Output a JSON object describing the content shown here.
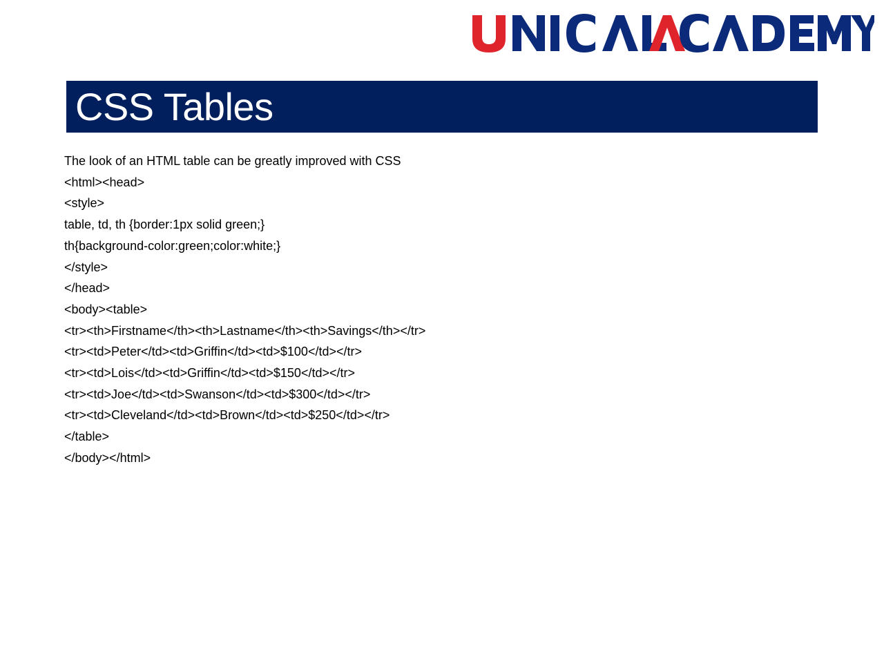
{
  "logo": {
    "text_part1": "UNICAL",
    "text_part2": "ACADEMY",
    "accent_color": "#e0242b",
    "brand_color": "#0b2a7a"
  },
  "slide": {
    "title": "CSS Tables",
    "title_bar_color": "#001f5c",
    "lines": [
      "The look of an HTML table can be greatly improved with CSS",
      "<html><head>",
      "<style>",
      "table, td, th {border:1px solid green;}",
      "th{background-color:green;color:white;}",
      "</style>",
      "</head>",
      "<body><table>",
      "<tr><th>Firstname</th><th>Lastname</th><th>Savings</th></tr>",
      "<tr><td>Peter</td><td>Griffin</td><td>$100</td></tr>",
      "<tr><td>Lois</td><td>Griffin</td><td>$150</td></tr>",
      "<tr><td>Joe</td><td>Swanson</td><td>$300</td></tr>",
      "<tr><td>Cleveland</td><td>Brown</td><td>$250</td></tr>",
      "</table>",
      "</body></html>"
    ]
  }
}
